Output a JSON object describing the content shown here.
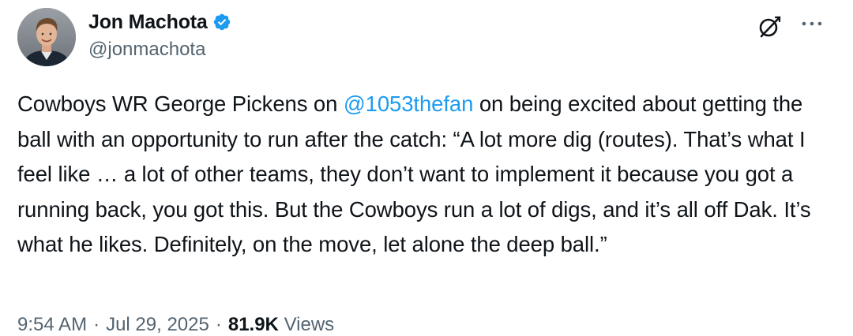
{
  "author": {
    "display_name": "Jon Machota",
    "handle": "@jonmachota",
    "verified": true,
    "verified_color": "#1d9bf0"
  },
  "actions": {
    "grok_icon": "grok-icon",
    "more_icon": "more-icon"
  },
  "tweet": {
    "text_before_mention": "Cowboys WR George Pickens on ",
    "mention": "@1053thefan",
    "text_after_mention": " on being excited about getting the ball with an opportunity to run after the catch: “A lot more dig (routes). That’s what I feel like … a lot of other teams, they don’t want to implement it because you got a running back, you got this. But the Cowboys run a lot of digs, and it’s all off Dak. It’s what he likes. Definitely, on the move, let alone the deep ball.”"
  },
  "meta": {
    "time": "9:54 AM",
    "separator": "·",
    "date": "Jul 29, 2025",
    "views_count": "81.9K",
    "views_label": "Views"
  },
  "colors": {
    "text": "#0f1419",
    "secondary": "#536471",
    "link": "#1d9bf0"
  }
}
